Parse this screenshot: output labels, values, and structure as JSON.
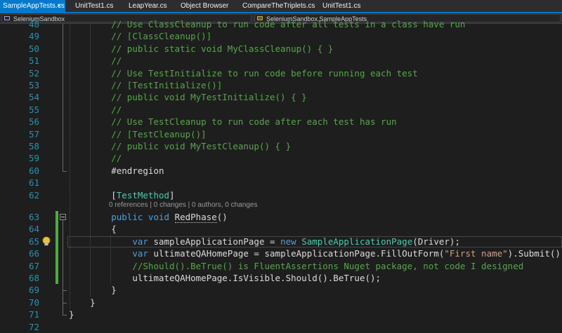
{
  "tabs": [
    {
      "label": "SampleAppTests.cs",
      "close": "×",
      "active": true
    },
    {
      "label": "UnitTest1.cs"
    },
    {
      "label": "LeapYear.cs"
    },
    {
      "label": "Object Browser"
    },
    {
      "label": "CompareTheTriplets.cs"
    },
    {
      "label": "UnitTest1.cs"
    }
  ],
  "navbar": {
    "project": "SeleniumSandbox",
    "type": "SeleniumSandbox.SampleAppTests"
  },
  "editor": {
    "codelens": "0 references | 0 changes | 0 authors, 0 changes",
    "lines": [
      {
        "num": "48",
        "segments": [
          {
            "cls": "c",
            "text": "// Use ClassCleanup to run code after all tests in a class have run"
          }
        ]
      },
      {
        "num": "49",
        "segments": [
          {
            "cls": "c",
            "text": "// [ClassCleanup()]"
          }
        ]
      },
      {
        "num": "50",
        "segments": [
          {
            "cls": "c",
            "text": "// public static void MyClassCleanup() { }"
          }
        ]
      },
      {
        "num": "51",
        "segments": [
          {
            "cls": "c",
            "text": "//"
          }
        ]
      },
      {
        "num": "52",
        "segments": [
          {
            "cls": "c",
            "text": "// Use TestInitialize to run code before running each test"
          }
        ]
      },
      {
        "num": "53",
        "segments": [
          {
            "cls": "c",
            "text": "// [TestInitialize()]"
          }
        ]
      },
      {
        "num": "54",
        "segments": [
          {
            "cls": "c",
            "text": "// public void MyTestInitialize() { }"
          }
        ]
      },
      {
        "num": "55",
        "segments": [
          {
            "cls": "c",
            "text": "//"
          }
        ]
      },
      {
        "num": "56",
        "segments": [
          {
            "cls": "c",
            "text": "// Use TestCleanup to run code after each test has run"
          }
        ]
      },
      {
        "num": "57",
        "segments": [
          {
            "cls": "c",
            "text": "// [TestCleanup()]"
          }
        ]
      },
      {
        "num": "58",
        "segments": [
          {
            "cls": "c",
            "text": "// public void MyTestCleanup() { }"
          }
        ]
      },
      {
        "num": "59",
        "segments": [
          {
            "cls": "c",
            "text": "//"
          }
        ]
      },
      {
        "num": "60",
        "segments": [
          {
            "cls": "",
            "text": "#endregion"
          }
        ]
      },
      {
        "num": "61",
        "segments": []
      },
      {
        "num": "62",
        "segments": [
          {
            "cls": "",
            "text": "["
          },
          {
            "cls": "t",
            "text": "TestMethod"
          },
          {
            "cls": "",
            "text": "]"
          }
        ]
      },
      {
        "num": "63",
        "segments": [
          {
            "cls": "k",
            "text": "public"
          },
          {
            "cls": "",
            "text": " "
          },
          {
            "cls": "k",
            "text": "void"
          },
          {
            "cls": "",
            "text": " "
          },
          {
            "cls": "squiggle",
            "text": "RedPhase"
          },
          {
            "cls": "",
            "text": "()"
          }
        ]
      },
      {
        "num": "64",
        "segments": [
          {
            "cls": "",
            "text": "{"
          }
        ]
      },
      {
        "num": "65",
        "segments": [
          {
            "cls": "",
            "text": "    "
          },
          {
            "cls": "k",
            "text": "var"
          },
          {
            "cls": "",
            "text": " sampleApplicationPage = "
          },
          {
            "cls": "k",
            "text": "new"
          },
          {
            "cls": "",
            "text": " "
          },
          {
            "cls": "t",
            "text": "SampleApplicationPage"
          },
          {
            "cls": "",
            "text": "(Driver);"
          }
        ]
      },
      {
        "num": "66",
        "segments": [
          {
            "cls": "",
            "text": "    "
          },
          {
            "cls": "k",
            "text": "var"
          },
          {
            "cls": "",
            "text": " ultimateQAHomePage = sampleApplicationPage.FillOutForm("
          },
          {
            "cls": "s",
            "text": "\"First name\""
          },
          {
            "cls": "",
            "text": ").Submit();"
          }
        ]
      },
      {
        "num": "67",
        "segments": [
          {
            "cls": "",
            "text": "    "
          },
          {
            "cls": "c",
            "text": "//Should().BeTrue() is FluentAssertions Nuget package, not code I designed"
          }
        ]
      },
      {
        "num": "68",
        "segments": [
          {
            "cls": "",
            "text": "    ultimateQAHomePage.IsVisible.Should().BeTrue();"
          }
        ]
      },
      {
        "num": "69",
        "segments": [
          {
            "cls": "",
            "text": "}"
          }
        ]
      },
      {
        "num": "70",
        "segments": [
          {
            "cls": "",
            "text": "}"
          }
        ]
      },
      {
        "num": "71",
        "segments": [
          {
            "cls": "",
            "text": "}"
          }
        ]
      },
      {
        "num": "72",
        "segments": []
      }
    ]
  }
}
